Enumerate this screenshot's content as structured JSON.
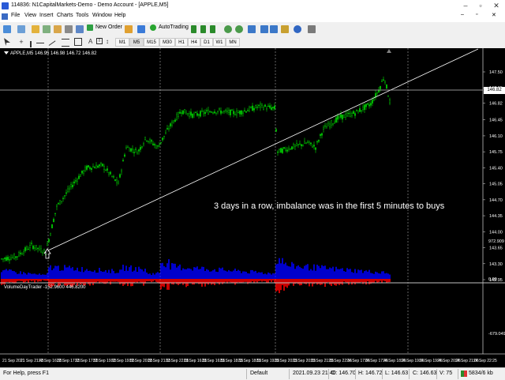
{
  "window": {
    "title": "114836: N1CapitalMarkets-Demo - Demo Account - [APPLE,M5]",
    "controls": [
      "–",
      "▫",
      "✕"
    ]
  },
  "menu": [
    "File",
    "View",
    "Insert",
    "Charts",
    "Tools",
    "Window",
    "Help"
  ],
  "toolbar": {
    "new_order": "New Order",
    "autotrading": "AutoTrading",
    "timeframes": [
      "M1",
      "M5",
      "M15",
      "M30",
      "H1",
      "H4",
      "D1",
      "W1",
      "MN"
    ]
  },
  "chart": {
    "header": "APPLE,M5  146.95 146.98 146.72 146.82",
    "price_labels": [
      "147.50",
      "147.15",
      "146.82",
      "146.45",
      "146.10",
      "145.75",
      "145.40",
      "145.05",
      "144.70",
      "144.35",
      "144.00",
      "143.65",
      "143.30",
      "142.95"
    ],
    "current_price": "146.82",
    "annotation": "3 days in a row, imbalance was in the first 5 minutes to buys",
    "indicator_header": "VolumeDayTrader -152.9600 446.8200",
    "indicator_labels": [
      "972.909",
      "0.00",
      "-679.049"
    ],
    "time_labels": [
      "21 Sep 2021",
      "21 Sep 21:45",
      "22 Sep 16:35",
      "22 Sep 17:15",
      "22 Sep 17:55",
      "22 Sep 19:15",
      "22 Sep 19:55",
      "22 Sep 20:35",
      "22 Sep 21:15",
      "22 Sep 22:05",
      "23 Sep 16:35",
      "23 Sep 16:55",
      "23 Sep 18:15",
      "23 Sep 18:55",
      "23 Sep 19:35",
      "23 Sep 20:15",
      "23 Sep 20:55",
      "23 Sep 21:35",
      "23 Sep 22:15",
      "24 Sep 17:05",
      "24 Sep 17:45",
      "24 Sep 18:25",
      "24 Sep 19:05",
      "24 Sep 19:45",
      "24 Sep 20:25",
      "24 Sep 21:05",
      "24 Sep 22:25"
    ],
    "colors": {
      "bull": "#00c000",
      "buy_volume": "#0000ff",
      "sell_volume": "#ff0000",
      "trendline": "#ffffff",
      "background": "#000000"
    },
    "session_starts_at": [
      "21 Sep 21:45",
      "22 Sep 22:05",
      "23 Sep 22:15"
    ]
  },
  "status": {
    "help": "For Help, press F1",
    "profile": "Default",
    "datetime": "2021.09.23 21:40",
    "open": "O: 146.70",
    "high": "H: 146.72",
    "low": "L: 146.63",
    "close": "C: 146.63",
    "volume": "V: 75",
    "traffic": "5834/6 kb"
  }
}
